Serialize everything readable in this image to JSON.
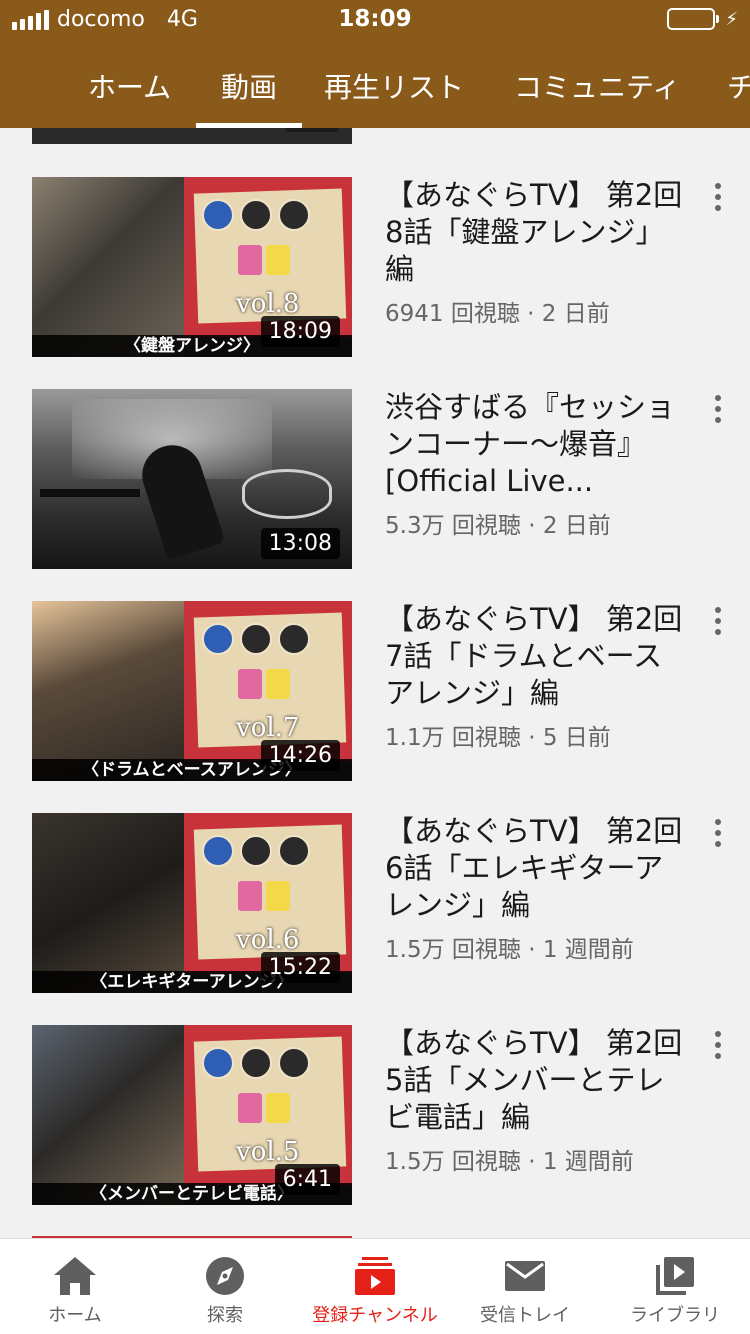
{
  "status_bar": {
    "carrier": "docomo",
    "network": "4G",
    "time": "18:09"
  },
  "channel_tabs": [
    {
      "label": "ホーム",
      "active": false
    },
    {
      "label": "動画",
      "active": true
    },
    {
      "label": "再生リスト",
      "active": false
    },
    {
      "label": "コミュニティ",
      "active": false
    },
    {
      "label": "チ",
      "active": false
    }
  ],
  "videos": [
    {
      "title": "【あなぐらTV】 第2回 8話「鍵盤アレンジ」編",
      "meta": "6941 回視聴 · 2 日前",
      "duration": "18:09",
      "thumb_caption": "〈鍵盤アレンジ〉",
      "thumb_vol": "vol.8"
    },
    {
      "title": "渋谷すばる『セッションコーナー〜爆音』 [Official Live...",
      "meta": "5.3万 回視聴 · 2 日前",
      "duration": "13:08"
    },
    {
      "title": "【あなぐらTV】 第2回 7話「ドラムとベースアレンジ」編",
      "meta": "1.1万 回視聴 · 5 日前",
      "duration": "14:26",
      "thumb_caption": "〈ドラムとベースアレンジ〉",
      "thumb_vol": "vol.7"
    },
    {
      "title": "【あなぐらTV】 第2回 6話「エレキギターアレンジ」編",
      "meta": "1.5万 回視聴 · 1 週間前",
      "duration": "15:22",
      "thumb_caption": "〈エレキギターアレンジ〉",
      "thumb_vol": "vol.6"
    },
    {
      "title": "【あなぐらTV】 第2回 5話「メンバーとテレビ電話」編",
      "meta": "1.5万 回視聴 · 1 週間前",
      "duration": "6:41",
      "thumb_caption": "〈メンバーとテレビ電話〉",
      "thumb_vol": "vol.5"
    }
  ],
  "bottom_nav": [
    {
      "label": "ホーム",
      "icon": "home-icon",
      "active": false
    },
    {
      "label": "探索",
      "icon": "compass-icon",
      "active": false
    },
    {
      "label": "登録チャンネル",
      "icon": "subscriptions-icon",
      "active": true
    },
    {
      "label": "受信トレイ",
      "icon": "inbox-icon",
      "active": false
    },
    {
      "label": "ライブラリ",
      "icon": "library-icon",
      "active": false
    }
  ],
  "colors": {
    "header": "#8a5a1a",
    "accent": "#e62117",
    "battery": "#4cd964"
  }
}
